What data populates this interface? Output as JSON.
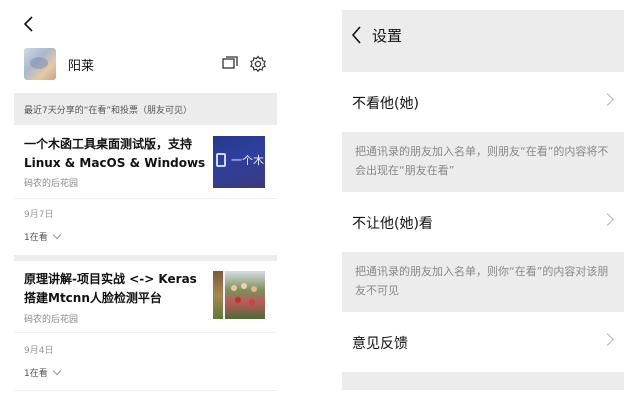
{
  "left": {
    "username": "阳莱",
    "section_header": "最近7天分享的“在看”和投票（朋友可见）",
    "articles": [
      {
        "title": "一个木函工具桌面测试版，支持Linux & MacOS & Windows",
        "source": "码农的后花园",
        "date": "9月7日",
        "likes": "1在看",
        "thumb_text": "一个木"
      },
      {
        "title": "原理讲解-项目实战 <-> Keras搭建Mtcnn人脸检测平台",
        "source": "码农的后花园",
        "date": "9月4日",
        "likes": "1在看"
      }
    ],
    "icons": [
      "back-chevron-icon",
      "message-icon",
      "gear-icon",
      "chevron-down-icon"
    ]
  },
  "right": {
    "title": "设置",
    "rows": [
      {
        "label": "不看他(她)",
        "desc": "把通讯录的朋友加入名单，则朋友“在看”的内容将不会出现在“朋友在看”"
      },
      {
        "label": "不让他(她)看",
        "desc": "把通讯录的朋友加入名单，则你“在看”的内容对该朋友不可见"
      },
      {
        "label": "意见反馈"
      }
    ]
  },
  "colors": {
    "background": "#ffffff",
    "panel_gray": "#ececec",
    "text_primary": "#111111",
    "text_secondary": "#888888"
  }
}
